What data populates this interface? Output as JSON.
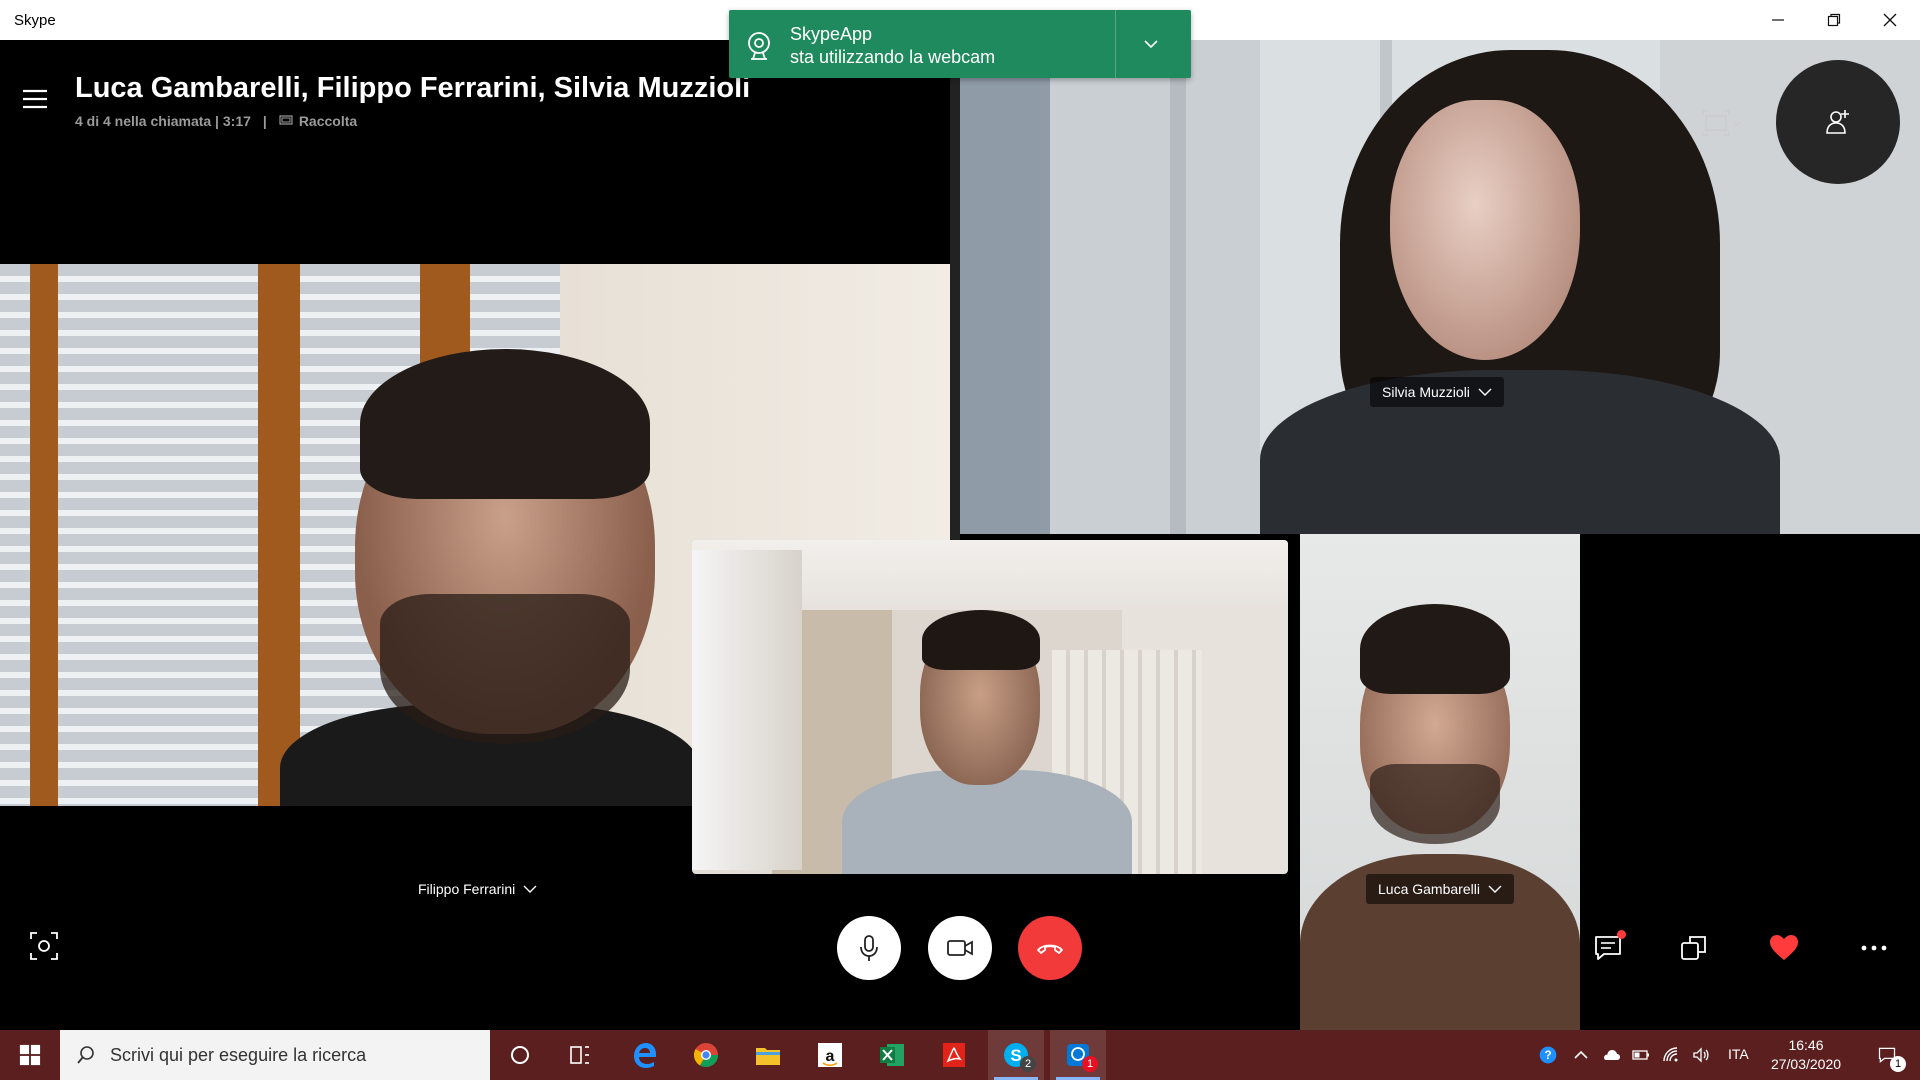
{
  "window": {
    "title": "Skype"
  },
  "notification": {
    "app": "SkypeApp",
    "message": "sta utilizzando la webcam"
  },
  "call": {
    "title": "Luca Gambarelli, Filippo Ferrarini, Silvia Muzzioli",
    "participants_status": "4 di 4 nella chiamata | 3:17",
    "separator": "|",
    "gallery_label": "Raccolta"
  },
  "participants": {
    "filippo": "Filippo Ferrarini",
    "silvia": "Silvia Muzzioli",
    "luca": "Luca Gambarelli"
  },
  "taskbar": {
    "search_placeholder": "Scrivi qui per eseguire la ricerca",
    "skype_badge": "2",
    "app_badge": "1",
    "notify_badge": "1",
    "language": "ITA",
    "time": "16:46",
    "date": "27/03/2020"
  },
  "colors": {
    "notification": "#1f8a5e",
    "hangup": "#f23a3a",
    "heart": "#ff3b3b",
    "taskbar": "#5b1f1f"
  }
}
